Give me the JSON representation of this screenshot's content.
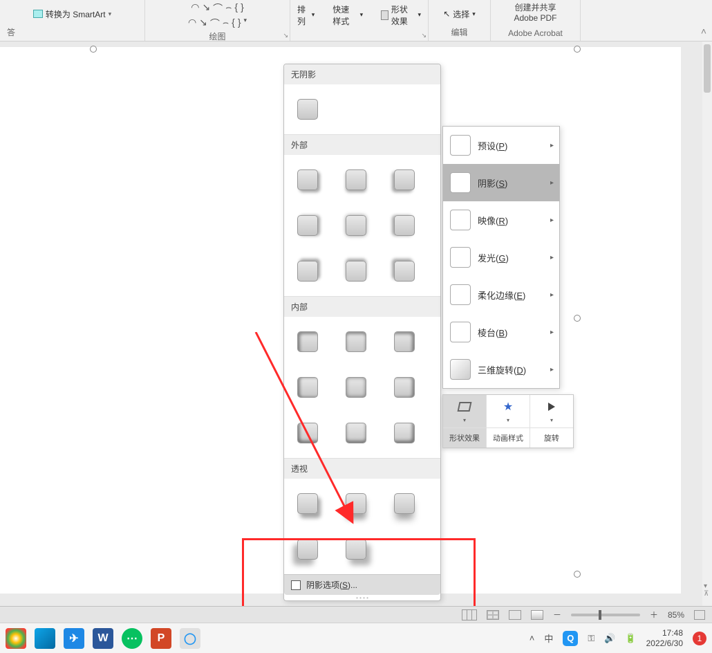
{
  "ribbon": {
    "smartart_label": "转换为 SmartArt",
    "group_draw": "绘图",
    "group_sort": "排列",
    "group_style": "快速样式",
    "shape_effects": "形状效果",
    "select": "选择",
    "group_edit": "编辑",
    "acrobat_create": "创建并共享",
    "acrobat_pdf": "Adobe PDF",
    "group_acrobat": "Adobe Acrobat"
  },
  "gallery": {
    "none": "无阴影",
    "outer": "外部",
    "inner": "内部",
    "perspective": "透视",
    "options": "阴影选项(S)..."
  },
  "fx": {
    "preset": "预设(P)",
    "shadow": "阴影(S)",
    "reflection": "映像(R)",
    "glow": "发光(G)",
    "soft": "柔化边缘(E)",
    "bevel": "棱台(B)",
    "rotate3d": "三维旋转(D)"
  },
  "mini": {
    "eff": "形状效果",
    "anim": "动画样式",
    "rot": "旋转"
  },
  "status": {
    "zoom": "85%",
    "minus": "－",
    "plus": "＋"
  },
  "taskbar": {
    "time": "17:48",
    "date": "2022/6/30",
    "badge": "1"
  }
}
